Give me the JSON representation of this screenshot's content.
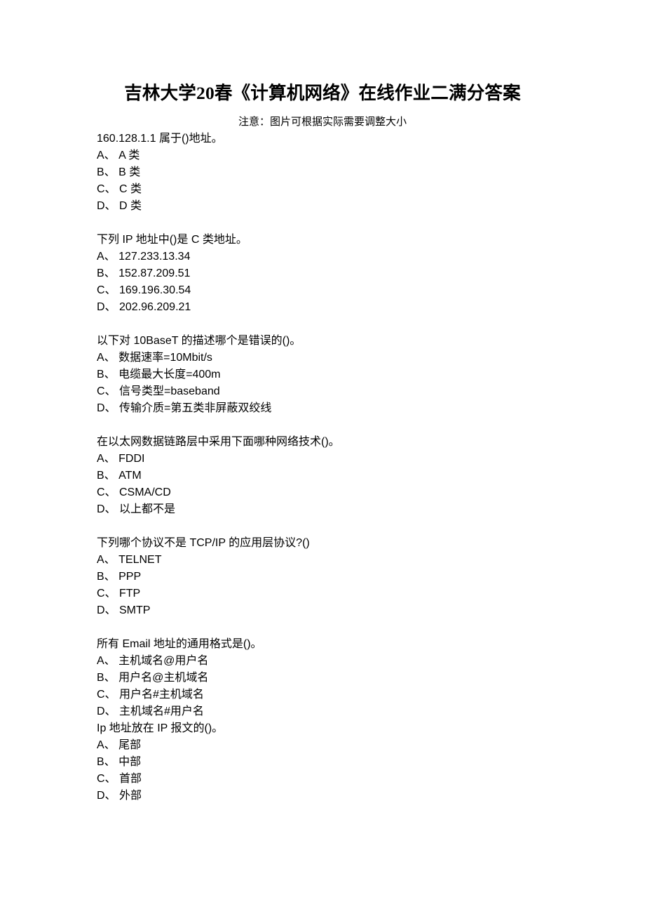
{
  "document": {
    "title": "吉林大学20春《计算机网络》在线作业二满分答案",
    "subtitle": "注意：图片可根据实际需要调整大小",
    "questions": [
      {
        "stem": "160.128.1.1 属于()地址。",
        "options": [
          "A、 A 类",
          "B、 B 类",
          "C、 C 类",
          "D、 D 类"
        ],
        "gap_before": false
      },
      {
        "stem": "下列 IP 地址中()是 C 类地址。",
        "options": [
          "A、 127.233.13.34",
          "B、 152.87.209.51",
          "C、 169.196.30.54",
          "D、 202.96.209.21"
        ],
        "gap_before": true
      },
      {
        "stem": "以下对 10BaseT 的描述哪个是错误的()。",
        "options": [
          "A、 数据速率=10Mbit/s",
          "B、 电缆最大长度=400m",
          "C、 信号类型=baseband",
          "D、 传输介质=第五类非屏蔽双绞线"
        ],
        "gap_before": true
      },
      {
        "stem": "在以太网数据链路层中采用下面哪种网络技术()。",
        "options": [
          "A、 FDDI",
          "B、 ATM",
          "C、 CSMA/CD",
          "D、 以上都不是"
        ],
        "gap_before": true
      },
      {
        "stem": "下列哪个协议不是 TCP/IP 的应用层协议?()",
        "options": [
          "A、 TELNET",
          "B、 PPP",
          "C、 FTP",
          "D、 SMTP"
        ],
        "gap_before": true
      },
      {
        "stem": "所有 Email 地址的通用格式是()。",
        "options": [
          "A、 主机域名@用户名",
          "B、 用户名@主机域名",
          "C、 用户名#主机域名",
          "D、 主机域名#用户名"
        ],
        "gap_before": true
      },
      {
        "stem": "Ip 地址放在 IP 报文的()。",
        "options": [
          "A、 尾部",
          "B、 中部",
          "C、 首部",
          "D、 外部"
        ],
        "gap_before": false
      }
    ]
  }
}
